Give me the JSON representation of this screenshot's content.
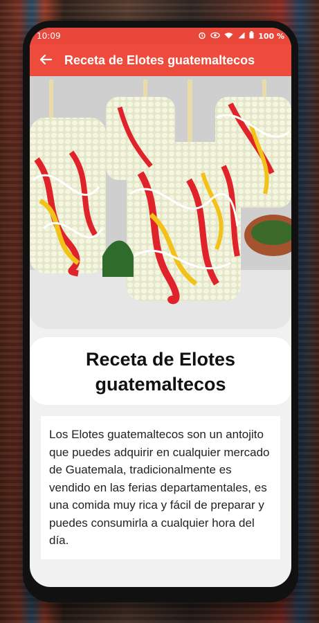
{
  "status_bar": {
    "time": "10:09",
    "battery": "100 %"
  },
  "app_bar": {
    "title": "Receta de Elotes guatemaltecos"
  },
  "hero": {
    "description": "Elotes locos"
  },
  "recipe": {
    "title": "Receta de Elotes guatemaltecos",
    "description": "Los Elotes guatemaltecos son un antojito que puedes adquirir en cualquier mercado de Guatemala, tradicionalmente es vendido en las ferias departamentales, es una comida muy rica y fácil de preparar y puedes consumirla a cualquier hora del día."
  },
  "colors": {
    "accent": "#ef4b3c",
    "status": "#e8473a"
  },
  "icons": {
    "back": "arrow-back-icon",
    "alarm": "alarm-icon",
    "eye": "eye-icon",
    "wifi": "wifi-icon",
    "signal": "signal-icon",
    "battery": "battery-icon"
  }
}
